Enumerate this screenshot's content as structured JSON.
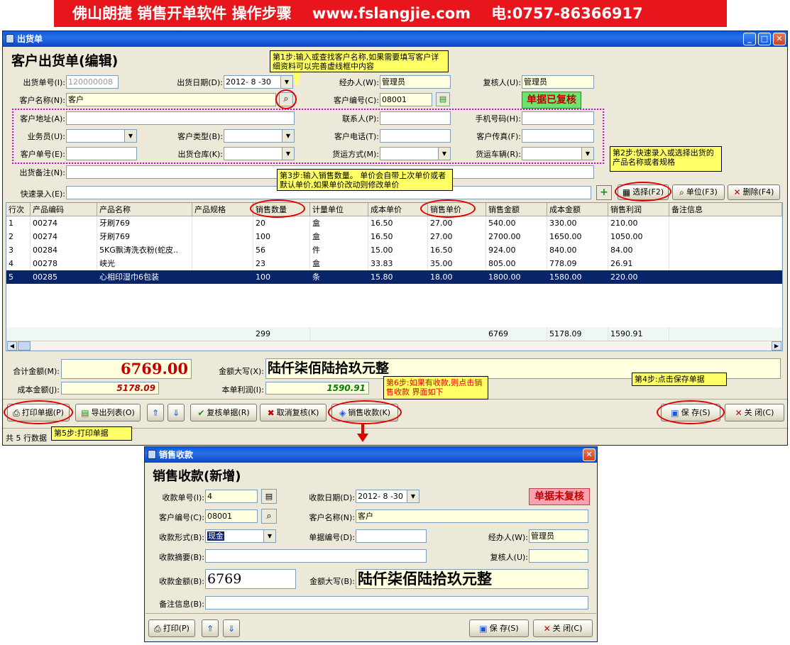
{
  "banner": {
    "text": "佛山朗捷 销售开单软件 操作步骤    www.fslangjie.com    电:0757-86366917"
  },
  "main_window": {
    "title": "出货单",
    "heading": "客户出货单(编辑)",
    "fields": {
      "order_no_label": "出货单号(I):",
      "order_no_value": "120000008",
      "date_label": "出货日期(D):",
      "date_value": "2012- 8 -30",
      "handler_label": "经办人(W):",
      "handler_value": "管理员",
      "reviewer_label": "复核人(U):",
      "reviewer_value": "管理员",
      "customer_name_label": "客户名称(N):",
      "customer_name_value": "客户",
      "customer_code_label": "客户编号(C):",
      "customer_code_value": "08001",
      "status_badge": "单据已复核",
      "address_label": "客户地址(A):",
      "contact_label": "联系人(P):",
      "mobile_label": "手机号码(H):",
      "salesman_label": "业务员(U):",
      "customer_type_label": "客户类型(B):",
      "phone_label": "客户电话(T):",
      "fax_label": "客户传真(F):",
      "customer_order_label": "客户单号(E):",
      "warehouse_label": "出货仓库(K):",
      "shipping_label": "货运方式(M):",
      "vehicle_label": "货运车辆(R):",
      "remark_label": "出货备注(N):",
      "quick_entry_label": "快速录入(E):"
    },
    "toolbar_right": {
      "select": "选择(F2)",
      "unit": "单位(F3)",
      "delete": "删除(F4)"
    },
    "table": {
      "columns": [
        "行次",
        "产品编码",
        "产品名称",
        "产品规格",
        "销售数量",
        "计量单位",
        "成本单价",
        "销售单价",
        "销售金额",
        "成本金额",
        "销售利润",
        "备注信息"
      ],
      "rows": [
        [
          "1",
          "00274",
          "牙刷769",
          "",
          "20",
          "盒",
          "16.50",
          "27.00",
          "540.00",
          "330.00",
          "210.00",
          ""
        ],
        [
          "2",
          "00274",
          "牙刷769",
          "",
          "100",
          "盒",
          "16.50",
          "27.00",
          "2700.00",
          "1650.00",
          "1050.00",
          ""
        ],
        [
          "3",
          "00284",
          "5KG飘涛洗衣粉(蛇皮..",
          "",
          "56",
          "件",
          "15.00",
          "16.50",
          "924.00",
          "840.00",
          "84.00",
          ""
        ],
        [
          "4",
          "00278",
          "峡光",
          "",
          "23",
          "盒",
          "33.83",
          "35.00",
          "805.00",
          "778.09",
          "26.91",
          ""
        ],
        [
          "5",
          "00285",
          "心相印湿巾6包装",
          "",
          "100",
          "条",
          "15.80",
          "18.00",
          "1800.00",
          "1580.00",
          "220.00",
          ""
        ]
      ],
      "totals": {
        "qty": "299",
        "sales": "6769",
        "cost": "5178.09",
        "profit": "1590.91"
      }
    },
    "summary": {
      "total_label": "合计金额(M):",
      "total_value": "6769.00",
      "amount_words_label": "金额大写(X):",
      "amount_words_value": "陆仟柒佰陆拾玖元整",
      "cost_label": "成本金额(J):",
      "cost_value": "5178.09",
      "profit_label": "本单利润(I):",
      "profit_value": "1590.91"
    },
    "buttons": {
      "print": "打印单据(P)",
      "export": "导出列表(O)",
      "review": "复核单据(R)",
      "cancel_review": "取消复核(K)",
      "receipt": "销售收款(K)",
      "save": "保 存(S)",
      "close": "关 闭(C)"
    },
    "status_text": "共 5 行数据"
  },
  "callouts": {
    "step1": "第1步:输入或查找客户名称,如果需要填写客户详细资料可以完善虚线框中内容",
    "step2": "第2步:快速录入或选择出货的产品名称或者规格",
    "step3": "第3步:输入销售数量。 单价会自带上次单价或者默认单价,如果单价改动则修改单价",
    "step4": "第4步:点击保存单据",
    "step5": "第5步:打印单据",
    "step6": "第6步:如果有收款,则点击销售收款 界面如下"
  },
  "receipt_window": {
    "title": "销售收款",
    "heading": "销售收款(新增)",
    "status_badge": "单据未复核",
    "fields": {
      "receipt_no_label": "收款单号(I):",
      "receipt_no_value": "4",
      "receipt_date_label": "收款日期(D):",
      "receipt_date_value": "2012- 8 -30",
      "customer_code_label": "客户编号(C):",
      "customer_code_value": "08001",
      "customer_name_label": "客户名称(N):",
      "customer_name_value": "客户",
      "method_label": "收款形式(B):",
      "method_value": "现金",
      "doc_no_label": "单据编号(D):",
      "handler_label": "经办人(W):",
      "handler_value": "管理员",
      "summary_label": "收款摘要(B):",
      "reviewer_label": "复核人(U):",
      "amount_label": "收款金额(B):",
      "amount_value": "6769",
      "amount_words_label": "金额大写(B):",
      "amount_words_value": "陆仟柒佰陆拾玖元整",
      "remark_label": "备注信息(B):"
    },
    "buttons": {
      "print": "打印(P)",
      "save": "保 存(S)",
      "close": "关 闭(C)"
    }
  },
  "colors": {
    "banner": "#e8151c",
    "callout": "#ffff66",
    "highlight_ring": "#e00000",
    "total_red": "#c00000",
    "profit_green": "#008000"
  }
}
